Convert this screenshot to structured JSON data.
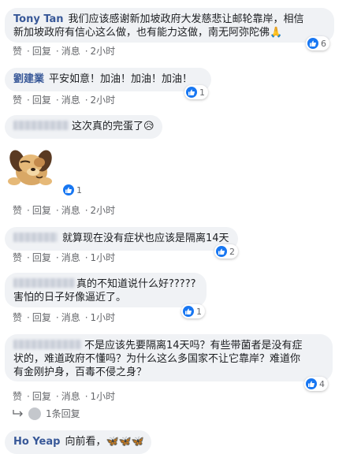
{
  "comments": [
    {
      "author": "Tony Tan",
      "text": "我们应该感谢新加坡政府大发慈悲让邮轮靠岸，相信新加坡政府有信心这么做，也有能力这做，南无阿弥陀佛🙏",
      "line1": "我们应该感谢新加坡政府大发慈悲让邮轮靠岸，相信",
      "line2": "新加坡政府有信心这么做，也有能力这做，南无阿弥陀佛🙏",
      "likes": "6",
      "time": "2小时"
    },
    {
      "author": "劉建業",
      "text": "平安如意！加油！加油！加油！",
      "likes": "1",
      "time": "2小时"
    },
    {
      "text": "这次真的完蛋了😥",
      "likes": "1",
      "time": "2小时",
      "sticker": "crying-dog-sticker"
    },
    {
      "text": "就算现在没有症状也应该是隔离14天",
      "likes": "2",
      "time": "1小时"
    },
    {
      "line1": "真的不知道说什么好?????",
      "line2": "害怕的日子好像逼近了。",
      "likes": "1",
      "time": "1小时"
    },
    {
      "line1": "不是应该先要隔离14天吗？有些带菌者是没有症",
      "line2": "状的，难道政府不懂吗？为什么这么多国家不让它靠岸？难道你",
      "line3": "有金刚护身，百毒不侵之身？",
      "likes": "4",
      "time": "1小时",
      "replies": "1条回复"
    },
    {
      "author": "Ho Yeap",
      "text": "向前看，🦋🦋🦋"
    }
  ],
  "actions": {
    "like": "赞",
    "reply": "回复",
    "message": "消息",
    "dot": "·"
  },
  "colors": {
    "bubble": "#f0f2f5",
    "author": "#385898",
    "like": "#1877f2",
    "meta": "#65676b"
  }
}
